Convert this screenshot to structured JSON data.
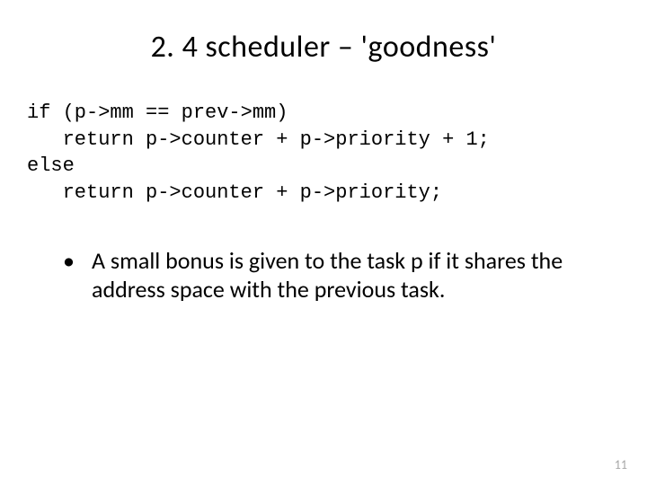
{
  "slide": {
    "title": "2. 4 scheduler – 'goodness'",
    "code": "if (p->mm == prev->mm)\n   return p->counter + p->priority + 1;\nelse\n   return p->counter + p->priority;",
    "bullets": [
      "A small bonus is given to the task p if it shares the address space with the previous task."
    ],
    "page_number": "11"
  }
}
